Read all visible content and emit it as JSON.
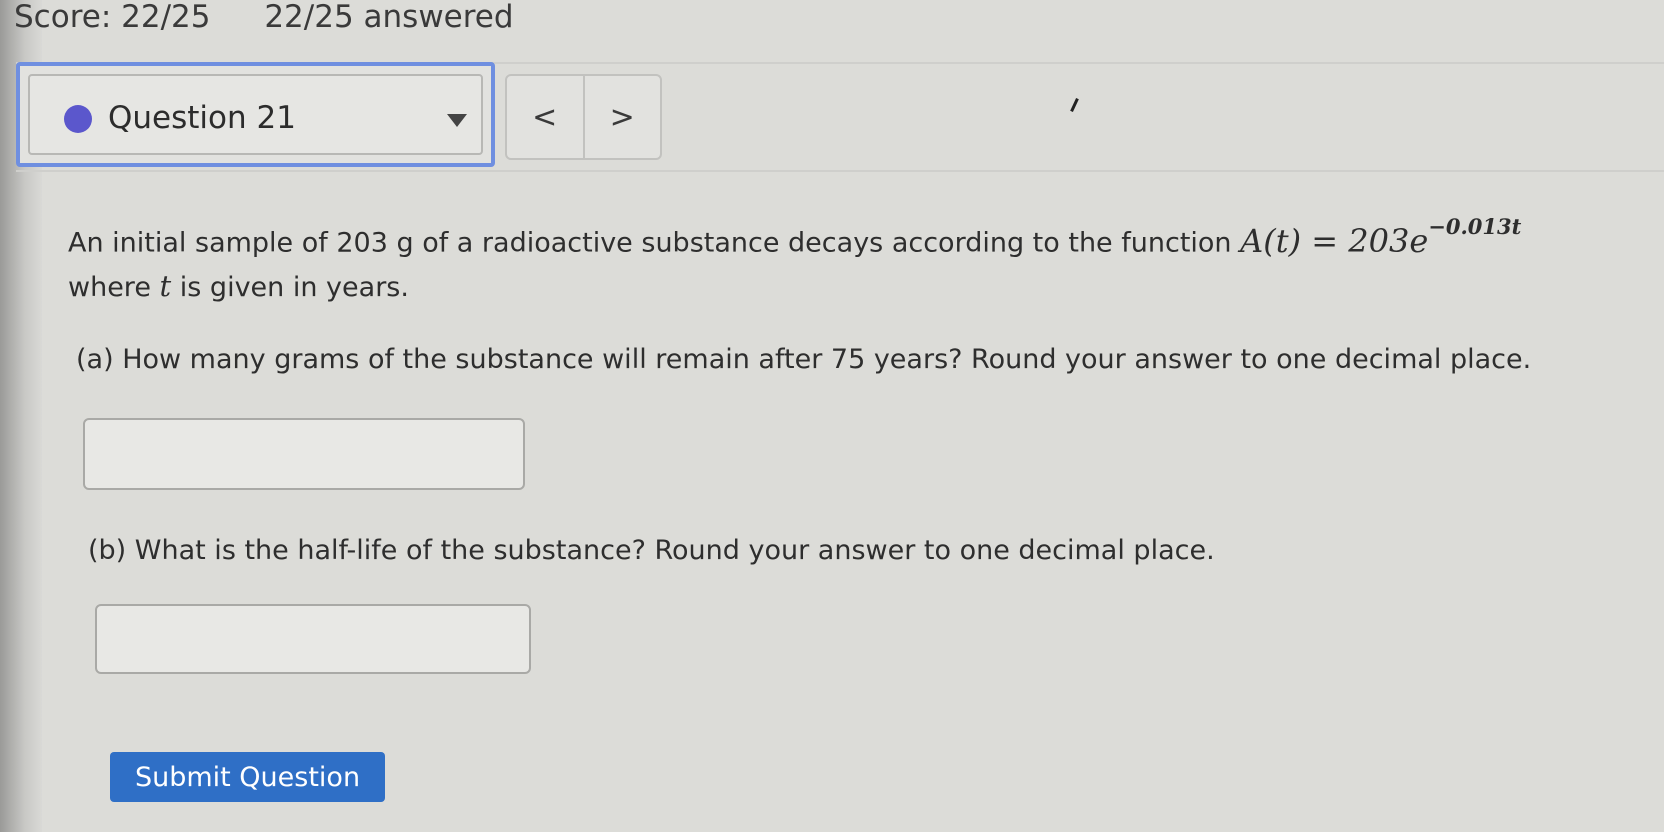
{
  "header": {
    "score": "Score: 22/25",
    "answered": "22/25 answered"
  },
  "question_nav": {
    "label": "Question 21",
    "prev_icon": "chevron-left-icon",
    "next_icon": "chevron-right-icon",
    "prev_glyph": "<",
    "next_glyph": ">",
    "status_color": "#5b57cc"
  },
  "question": {
    "intro": "An initial sample of 203 g of a radioactive substance decays according to the function",
    "function_lhs": "A(t) = 203e",
    "function_exponent": "−0.013t",
    "line2_prefix": "where",
    "line2_var": "t",
    "line2_suffix": "is given in years.",
    "part_a": "(a) How many grams of the substance will remain after 75 years? Round your answer to one decimal place.",
    "part_a_value": "",
    "part_b": "(b) What is the half-life of the substance? Round your answer to one decimal place.",
    "part_b_value": ""
  },
  "actions": {
    "submit_label": "Submit Question",
    "submit_color": "#2f6fc6"
  }
}
